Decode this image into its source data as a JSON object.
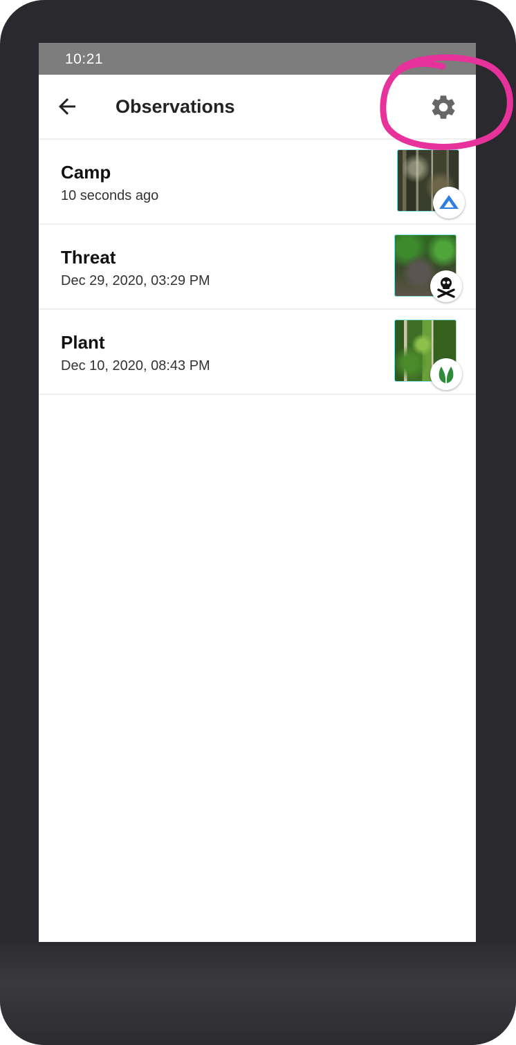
{
  "status_bar": {
    "time": "10:21"
  },
  "app_bar": {
    "title": "Observations",
    "back_icon": "arrow-left-icon",
    "settings_icon": "gear-icon"
  },
  "observations": [
    {
      "title": "Camp",
      "date": "10 seconds ago",
      "icon": "camp-tent-icon"
    },
    {
      "title": "Threat",
      "date": "Dec 29, 2020, 03:29 PM",
      "icon": "skull-crossbones-icon"
    },
    {
      "title": "Plant",
      "date": "Dec 10, 2020, 08:43 PM",
      "icon": "leaf-icon"
    }
  ],
  "colors": {
    "status_bar": "#7d7d7d",
    "device_frame": "#2a2a2e",
    "annotation": "#e8329b",
    "camp_icon": "#2f7de1",
    "threat_icon": "#111111",
    "plant_icon": "#2e8b3a",
    "settings_icon": "#666666"
  }
}
